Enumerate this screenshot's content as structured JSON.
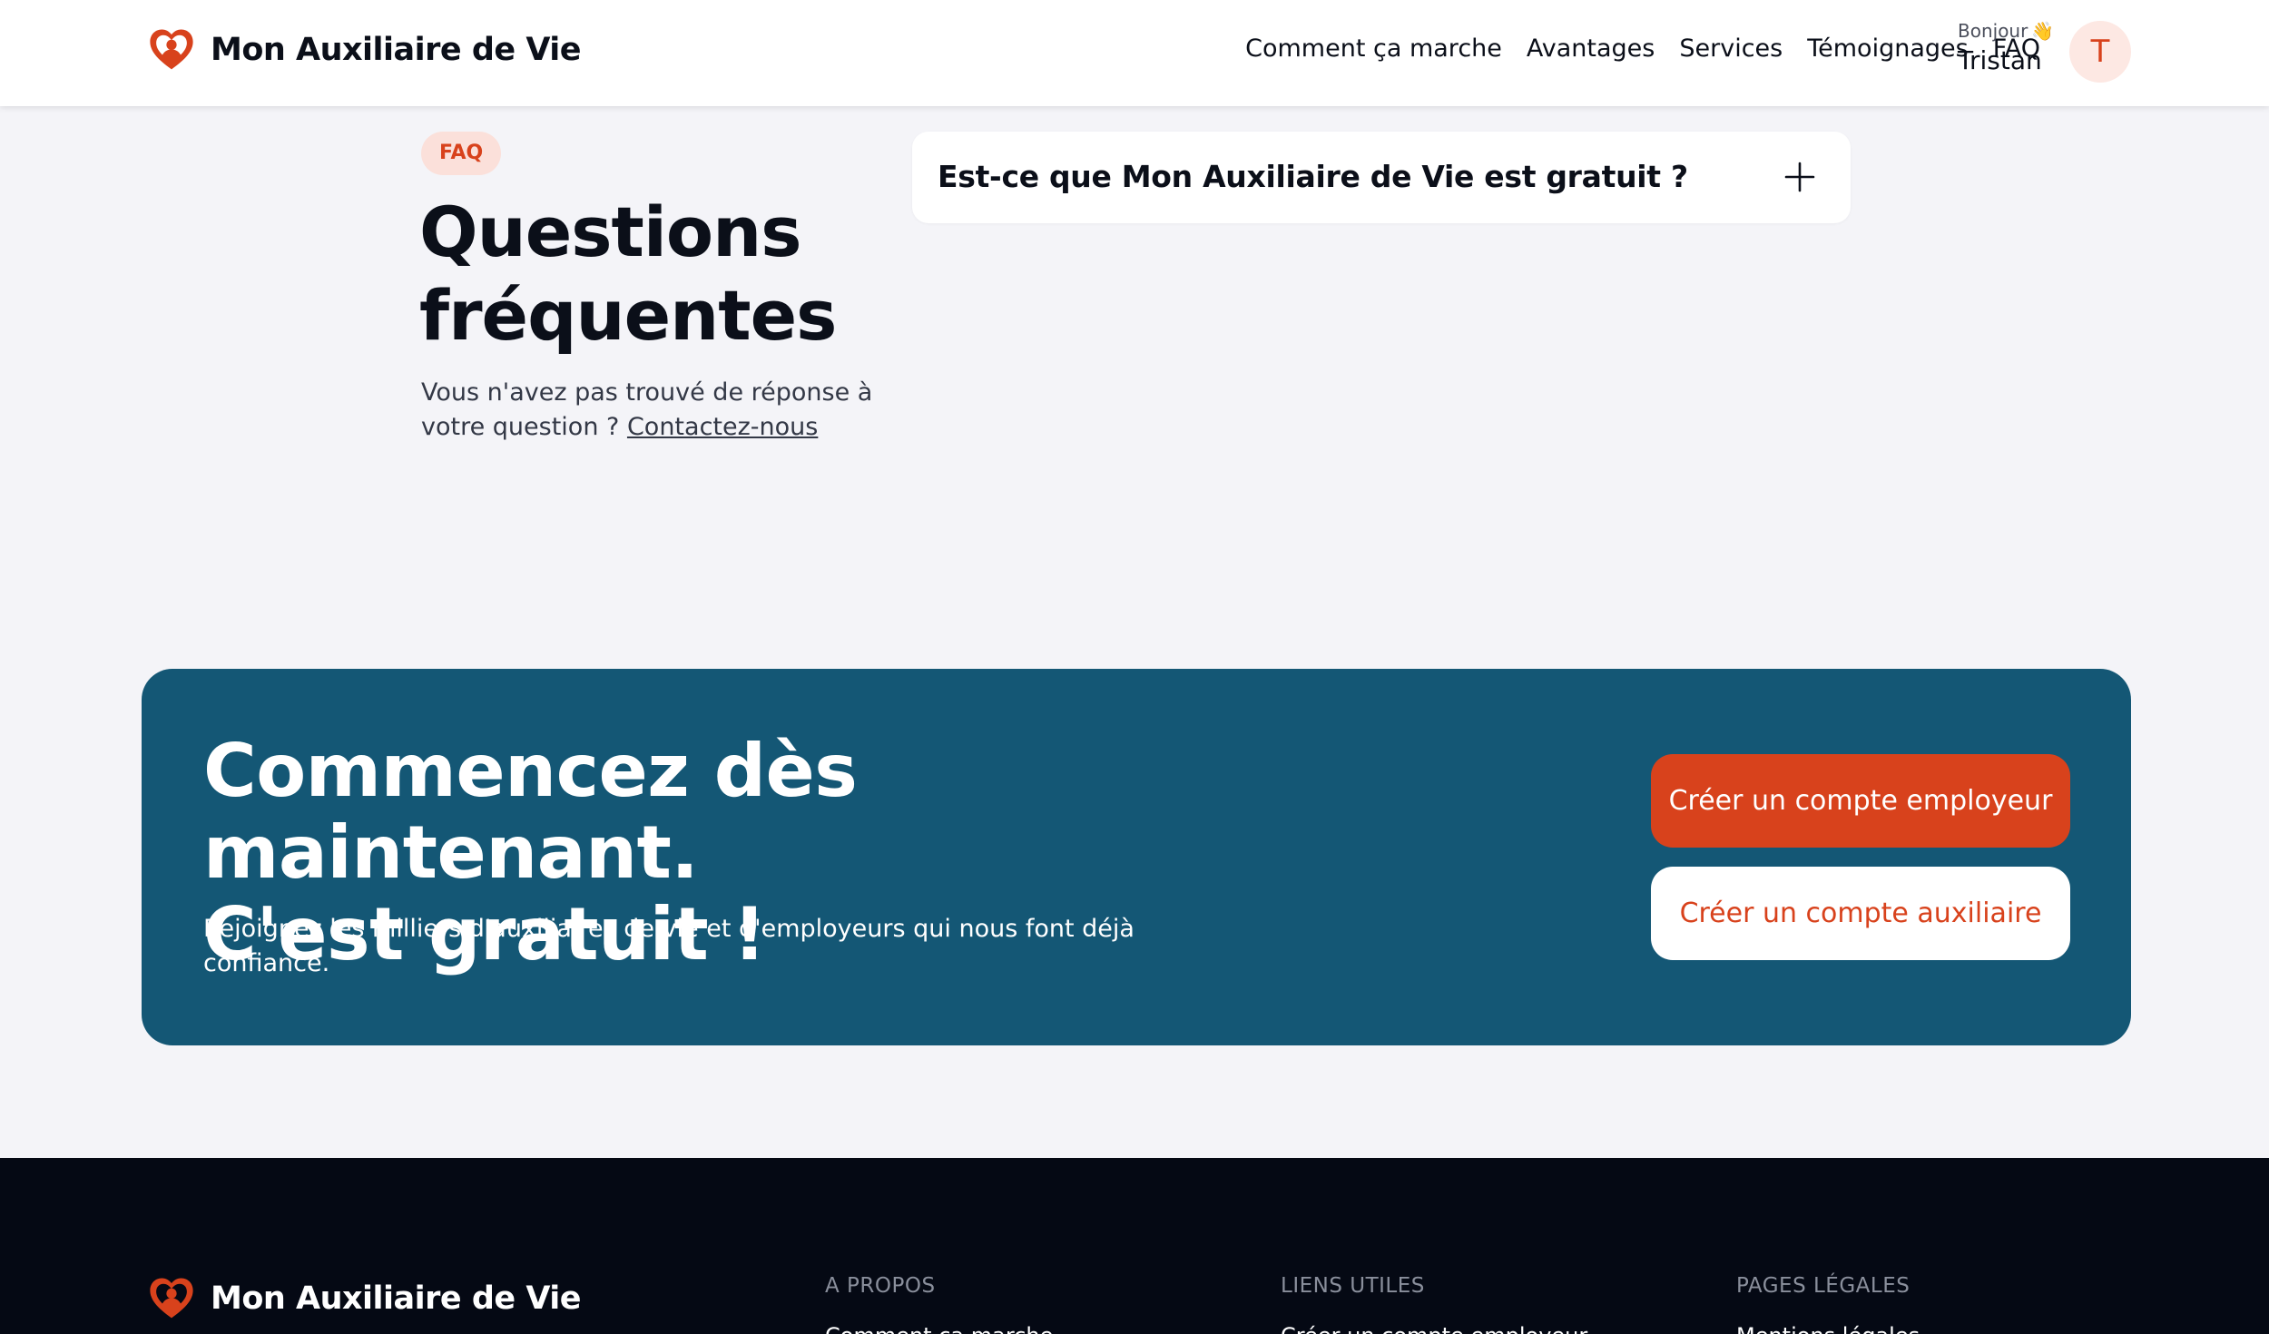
{
  "header": {
    "brand_name": "Mon Auxiliaire de Vie",
    "nav": [
      "Comment ça marche",
      "Avantages",
      "Services",
      "Témoignages",
      "FAQ"
    ],
    "greeting_small": "Bonjour",
    "greeting_emoji": "👋",
    "user_name": "Tristan",
    "avatar_initial": "T"
  },
  "faq": {
    "badge": "FAQ",
    "title": "Questions fréquentes",
    "subtitle": "Vous n'avez pas trouvé de réponse à votre question ?",
    "contact_link": "Contactez-nous",
    "items": [
      {
        "question": "Est-ce que Mon Auxiliaire de Vie est gratuit ?",
        "icon": "plus-icon"
      }
    ]
  },
  "cta": {
    "title_line1": "Commencez dès maintenant.",
    "title_line2": "C'est gratuit !",
    "subtitle": "Rejoignez les milliers d'auxiliaires de vie et d'employeurs qui nous font déjà confiance.",
    "primary_button": "Créer un compte employeur",
    "secondary_button": "Créer un compte auxiliaire"
  },
  "footer": {
    "brand_name": "Mon Auxiliaire de Vie",
    "headings": [
      "A PROPOS",
      "LIENS UTILES",
      "PAGES LÉGALES"
    ],
    "links": [
      "Comment ça marche",
      "Créer un compte employeur",
      "Mentions légales"
    ]
  },
  "colors": {
    "brand_red": "#d8421c",
    "cta_blue": "#145775",
    "footer_bg": "#050914",
    "page_bg": "#f4f4f8"
  }
}
